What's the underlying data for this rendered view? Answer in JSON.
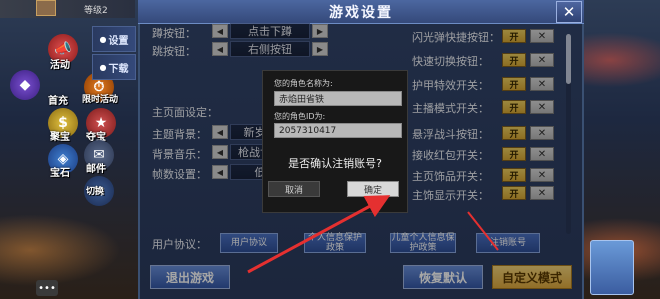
{
  "header": {
    "title": "游戏设置",
    "close_label": "✕"
  },
  "hud": {
    "player_level": "等级2"
  },
  "side_menu": {
    "items": [
      {
        "label": "活动"
      },
      {
        "label": "首充"
      },
      {
        "label": "限时活动"
      },
      {
        "label": "聚宝"
      },
      {
        "label": "夺宝"
      },
      {
        "label": "邮件"
      },
      {
        "label": "宝石"
      },
      {
        "label": "切换"
      }
    ],
    "tabs": [
      {
        "label": "设置"
      },
      {
        "label": "下载"
      }
    ]
  },
  "left_settings": {
    "rows": [
      {
        "label": "蹲按钮：",
        "value": "点击下蹲"
      },
      {
        "label": "跳按钮：",
        "value": "右侧按钮"
      }
    ],
    "section_title": "主页面设定：",
    "page_rows": [
      {
        "label": "主题背景：",
        "value": "新岁月"
      },
      {
        "label": "背景音乐：",
        "value": "枪战世界"
      },
      {
        "label": "帧数设置：",
        "value": "低"
      }
    ]
  },
  "right_settings": {
    "rows": [
      {
        "label": "闪光弹快捷按钮：",
        "state": "开"
      },
      {
        "label": "快速切换按钮：",
        "state": "开"
      },
      {
        "label": "护甲特效开关：",
        "state": "开"
      },
      {
        "label": "主播模式开关：",
        "state": "开"
      },
      {
        "label": "悬浮战斗按钮：",
        "state": "开"
      },
      {
        "label": "接收红包开关：",
        "state": "开"
      },
      {
        "label": "主页饰品开关：",
        "state": "开"
      },
      {
        "label": "主饰显示开关：",
        "state": "开"
      }
    ],
    "off_symbol": "✕"
  },
  "protocol": {
    "label": "用户协议：",
    "buttons": [
      "用户协议",
      "个人信息保护政策",
      "儿童个人信息保护政策",
      "注销账号"
    ]
  },
  "bottom_buttons": {
    "exit": "退出游戏",
    "restore": "恢复默认",
    "custom": "自定义模式"
  },
  "dialog": {
    "name_label": "您的角色名称为:",
    "name_value": "赤焰田省铁",
    "id_label": "您的角色ID为:",
    "id_value": "2057310417",
    "question": "是否确认注销账号?",
    "cancel": "取消",
    "confirm": "确定"
  },
  "colors": {
    "panel": "#2b3b5e",
    "accent_blue": "#4c72c4",
    "toggle_on": "#e0b640",
    "annotation_red": "#e53030"
  }
}
